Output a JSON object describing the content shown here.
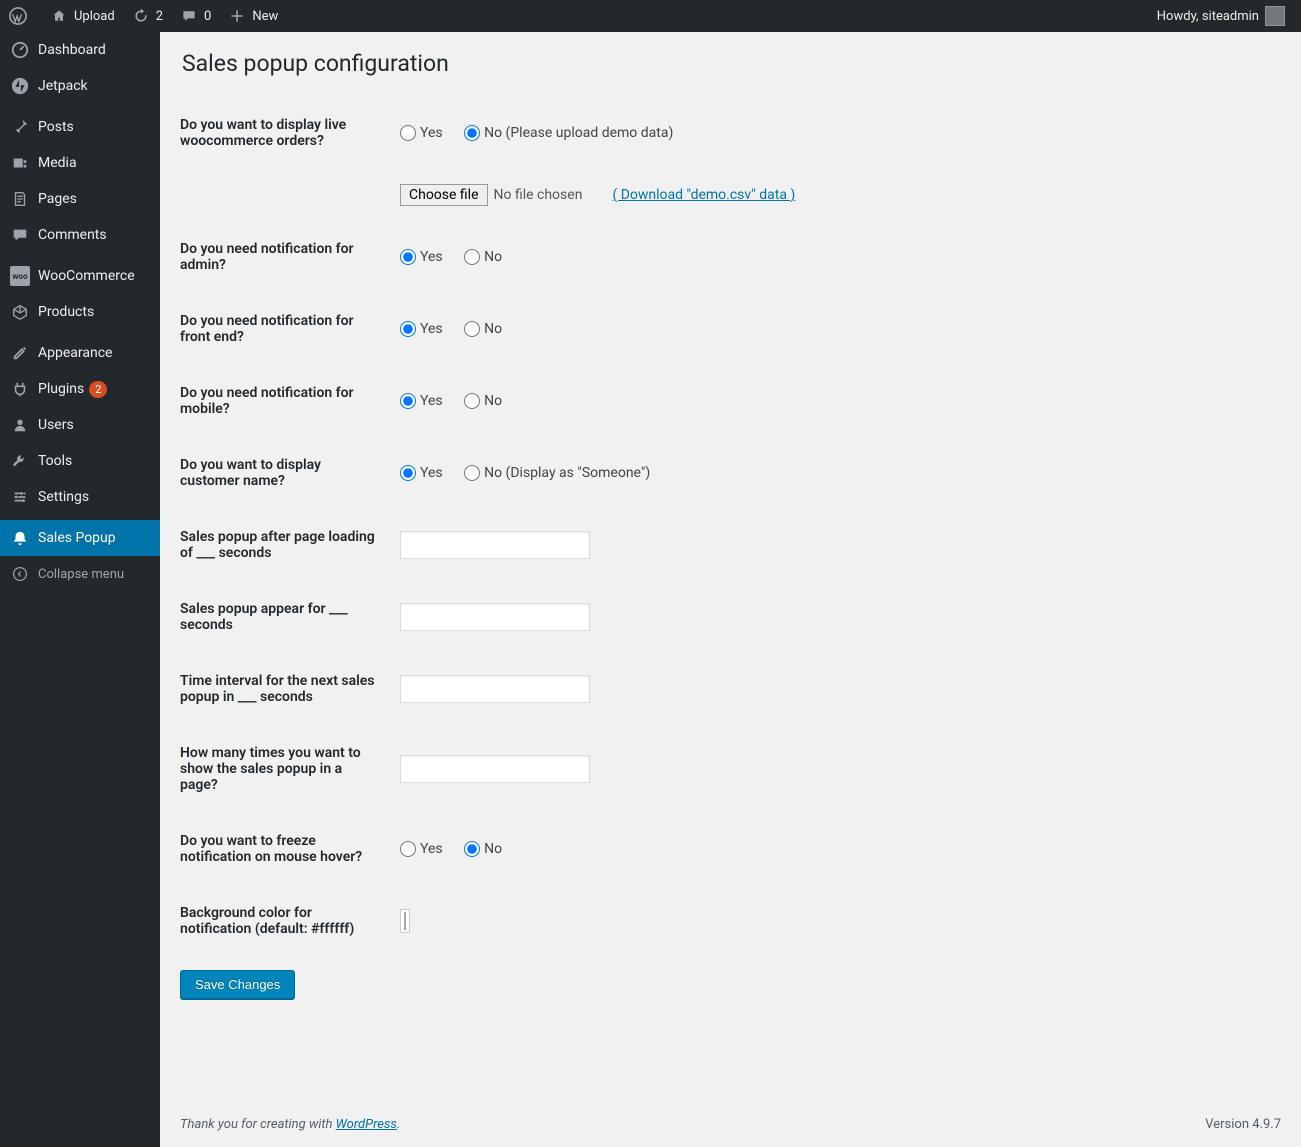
{
  "adminbar": {
    "site_name": "Upload",
    "updates_count": "2",
    "comments_count": "0",
    "new_label": "New",
    "howdy": "Howdy, siteadmin"
  },
  "menu": {
    "dashboard": "Dashboard",
    "jetpack": "Jetpack",
    "posts": "Posts",
    "media": "Media",
    "pages": "Pages",
    "comments": "Comments",
    "woocommerce": "WooCommerce",
    "products": "Products",
    "appearance": "Appearance",
    "plugins": "Plugins",
    "plugins_count": "2",
    "users": "Users",
    "tools": "Tools",
    "settings": "Settings",
    "sales_popup": "Sales Popup",
    "collapse": "Collapse menu"
  },
  "page": {
    "title": "Sales popup configuration",
    "fields": {
      "live_orders": {
        "label": "Do you want to display live woocommerce orders?",
        "yes": "Yes",
        "no": "No (Please upload demo data)",
        "selected": "no"
      },
      "file": {
        "choose": "Choose file",
        "status": "No file chosen",
        "download": "( Download \"demo.csv\" data )"
      },
      "notif_admin": {
        "label": "Do you need notification for admin?",
        "yes": "Yes",
        "no": "No",
        "selected": "yes"
      },
      "notif_front": {
        "label": "Do you need notification for front end?",
        "yes": "Yes",
        "no": "No",
        "selected": "yes"
      },
      "notif_mobile": {
        "label": "Do you need notification for mobile?",
        "yes": "Yes",
        "no": "No",
        "selected": "yes"
      },
      "cust_name": {
        "label": "Do you want to display customer name?",
        "yes": "Yes",
        "no": "No (Display as \"Someone\")",
        "selected": "yes"
      },
      "after_load": {
        "label": "Sales popup after page loading of ___ seconds",
        "value": ""
      },
      "appear_for": {
        "label": "Sales popup appear for ___ seconds",
        "value": ""
      },
      "interval": {
        "label": "Time interval for the next sales popup in ___ seconds",
        "value": ""
      },
      "times": {
        "label": "How many times you want to show the sales popup in a page?",
        "value": ""
      },
      "freeze": {
        "label": "Do you want to freeze notification on mouse hover?",
        "yes": "Yes",
        "no": "No",
        "selected": "no"
      },
      "bgcolor": {
        "label": "Background color for notification (default: #ffffff)",
        "value": "#ffffff"
      }
    },
    "save": "Save Changes"
  },
  "footer": {
    "thanks_prefix": "Thank you for creating with ",
    "thanks_link": "WordPress",
    "thanks_suffix": ".",
    "version": "Version 4.9.7"
  }
}
